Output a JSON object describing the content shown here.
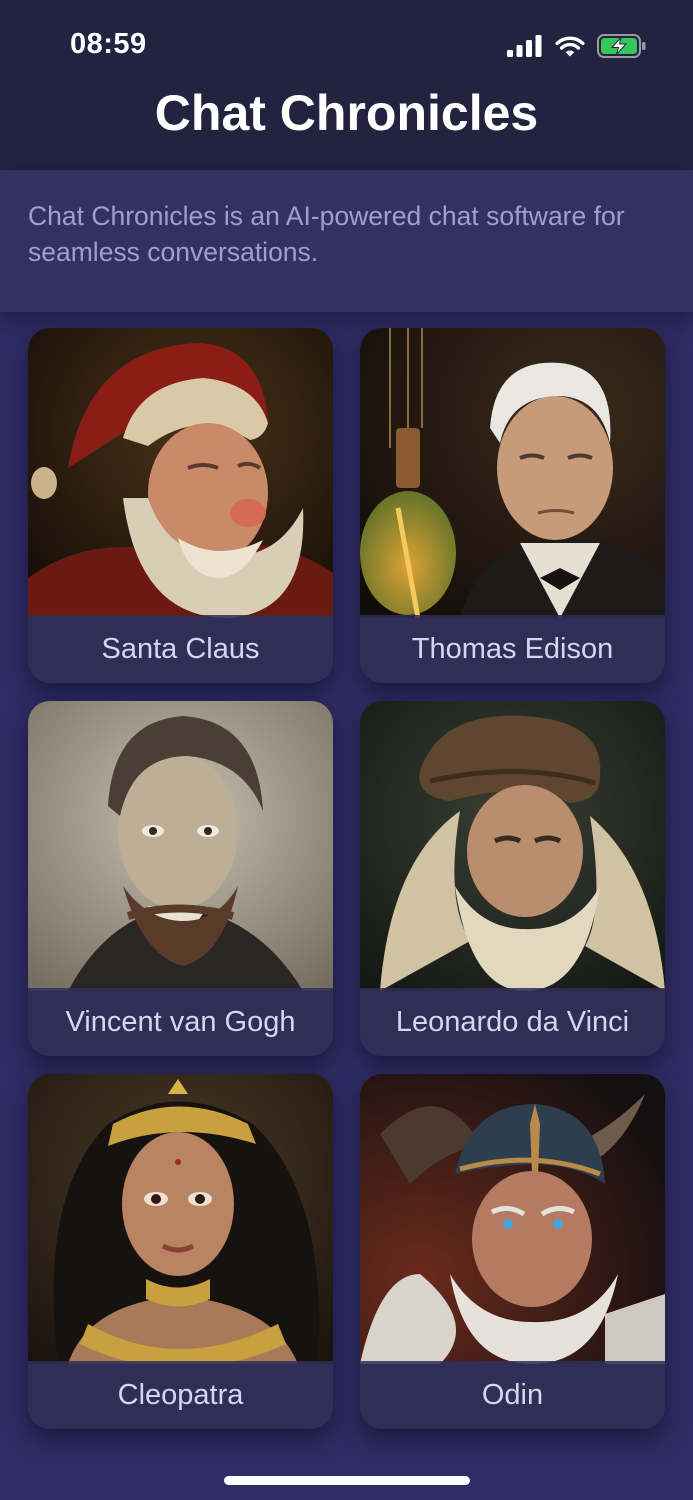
{
  "status_bar": {
    "time": "08:59",
    "icons": [
      "cellular-signal-icon",
      "wifi-icon",
      "battery-charging-icon"
    ]
  },
  "header": {
    "title": "Chat Chronicles"
  },
  "description": "Chat Chronicles is an AI-powered chat software for seamless conversations.",
  "characters": [
    {
      "name": "Santa Claus"
    },
    {
      "name": "Thomas Edison"
    },
    {
      "name": "Vincent van Gogh"
    },
    {
      "name": "Leonardo da Vinci"
    },
    {
      "name": "Cleopatra"
    },
    {
      "name": "Odin"
    }
  ],
  "colors": {
    "page_background": "#2e2c63",
    "header_background": "#23233f",
    "description_background": "#33325f",
    "description_text": "#9f9cd6",
    "card_label_text": "#d7d5ee",
    "battery_green": "#35c759"
  }
}
